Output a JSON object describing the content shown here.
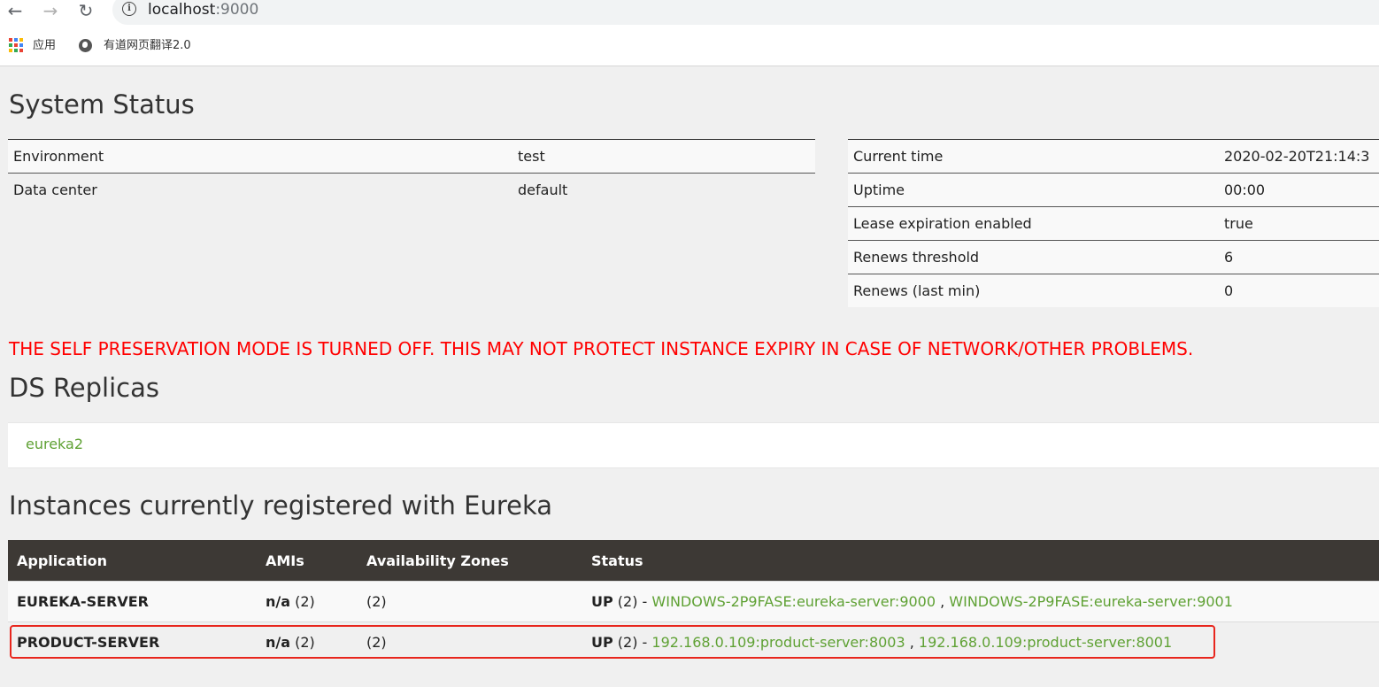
{
  "browser": {
    "url_host": "localhost",
    "url_port": ":9000",
    "bookmarks": [
      {
        "label": "应用"
      },
      {
        "label": "有道网页翻译2.0"
      }
    ]
  },
  "system_status": {
    "heading": "System Status",
    "left": [
      {
        "label": "Environment",
        "value": "test"
      },
      {
        "label": "Data center",
        "value": "default"
      }
    ],
    "right": [
      {
        "label": "Current time",
        "value": "2020-02-20T21:14:3"
      },
      {
        "label": "Uptime",
        "value": "00:00"
      },
      {
        "label": "Lease expiration enabled",
        "value": "true"
      },
      {
        "label": "Renews threshold",
        "value": "6"
      },
      {
        "label": "Renews (last min)",
        "value": "0"
      }
    ]
  },
  "warning": "THE SELF PRESERVATION MODE IS TURNED OFF. THIS MAY NOT PROTECT INSTANCE EXPIRY IN CASE OF NETWORK/OTHER PROBLEMS.",
  "ds_replicas": {
    "heading": "DS Replicas",
    "items": [
      "eureka2"
    ]
  },
  "instances": {
    "heading": "Instances currently registered with Eureka",
    "columns": [
      "Application",
      "AMIs",
      "Availability Zones",
      "Status"
    ],
    "rows": [
      {
        "application": "EUREKA-SERVER",
        "amis_bold": "n/a",
        "amis_count": " (2)",
        "zones": "(2)",
        "status_prefix": "UP",
        "status_count": " (2) - ",
        "link1": "WINDOWS-2P9FASE:eureka-server:9000",
        "sep": " , ",
        "link2": "WINDOWS-2P9FASE:eureka-server:9001"
      },
      {
        "application": "PRODUCT-SERVER",
        "amis_bold": "n/a",
        "amis_count": " (2)",
        "zones": "(2)",
        "status_prefix": "UP",
        "status_count": " (2) - ",
        "link1": "192.168.0.109:product-server:8003",
        "sep": " , ",
        "link2": "192.168.0.109:product-server:8001"
      }
    ]
  },
  "colors": {
    "link_green": "#5fa134",
    "warning_red": "#ff0000",
    "table_header_bg": "#3d3935",
    "highlight_border": "#e8261d"
  }
}
